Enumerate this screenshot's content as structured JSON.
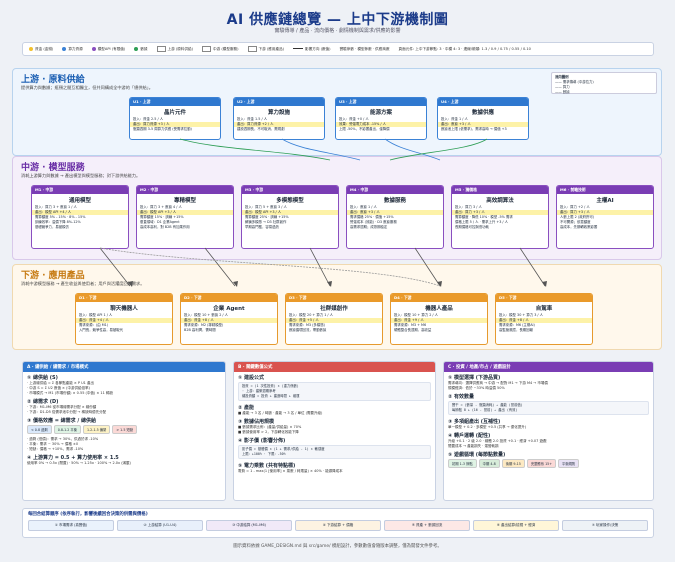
{
  "header": {
    "title": "AI 供應鏈總覽 — 上中下游機制圖",
    "subtitle": "實驗傳導 / 產品 · 流向價格 · 劇情機制與需求/供應的影響"
  },
  "legend": {
    "items": [
      {
        "label": "資金 (金錢)",
        "color": "#f2c12e",
        "kind": "dot"
      },
      {
        "label": "算力資源",
        "color": "#3b82d6",
        "kind": "dot"
      },
      {
        "label": "模型API (有限值)",
        "color": "#8a4fc0",
        "kind": "dot"
      },
      {
        "label": "數據",
        "color": "#2e9e55",
        "kind": "dot"
      },
      {
        "label": "上游 (原料供給)",
        "color": "#ffffff",
        "kind": "box"
      },
      {
        "label": "中游 (模型服務)",
        "color": "#ffffff",
        "kind": "box"
      },
      {
        "label": "下游 (應用產品)",
        "color": "#ffffff",
        "kind": "box"
      },
      {
        "label": "影響方向 (數值)",
        "color": "#333333",
        "kind": "line"
      },
      {
        "label": "實驗參數 · 模型參數 · 供應商數",
        "color": "#333333",
        "kind": "text"
      },
      {
        "label": "頁面元件: 上中下游節點: 3 · 中模 4: 3 · 連線/箭頭: 1.3 / 0.9 / 0.75 / 0.55 / 0.10",
        "color": "#333333",
        "kind": "text"
      }
    ]
  },
  "upstream": {
    "title": "上游 · 原料供給",
    "subtitle": "提供算力與數據；瓶頸之間互相獨立，但共同構成全中游的「總供給」。",
    "key_title": "流向圖例",
    "key_lines": [
      "—— 需求傳導 (中游拉力)",
      "—— 算力",
      "—— 數據"
    ],
    "cards": [
      {
        "code": "U1 · 上游",
        "name": "晶片元件",
        "lines": [
          "投入：資金 2.5 / 人",
          "產出：算力資源 +3 / 人",
          "瓶頸週期 3-5 周算力供應 (受需求拉動)"
        ]
      },
      {
        "code": "U2 · 上游",
        "name": "算力設施",
        "lines": [
          "投入：資金 1.5 / 人",
          "產出：算力資源 +2 / 人",
          "建設週期長，不可取消，需規劃"
        ]
      },
      {
        "code": "U3 · 上游",
        "name": "能源方案",
        "lines": [
          "投入：資金 +0 / 人",
          "效果：營運電力成本 -15% / 人",
          "上限 -50%，不影響產出，僅降價"
        ]
      },
      {
        "code": "U4 · 上游",
        "name": "數據供應",
        "lines": [
          "投入：資金 1 / 人",
          "產出：數據 +3 / 人",
          "數據池上限 (依需求)，需求高時 → 價值 +3"
        ]
      }
    ]
  },
  "midstream": {
    "title": "中游 · 模型服務",
    "subtitle": "消耗上游算力與數據 → 產出模型與模型服務；對下游供給能力。",
    "cards": [
      {
        "code": "M1 · 中游",
        "name": "通用模型",
        "lines": [
          "投入：算力 3 + 數據 1 / 人",
          "產出：模型 API +4 / 人",
          "需算額度 5% - 15% · 8% - 15%",
          "訓練效率：溢價下降 8%-12%",
          "基礎競爭力，易被模仿"
        ]
      },
      {
        "code": "M2 · 中游",
        "name": "專精模型",
        "lines": [
          "投入：算力 3 + 數據 4 / 人",
          "產出：模型 API +3 / 人",
          "需算額度 15% · 訓練 +15%",
          "垂直領域：D1 企業Agent",
          "高成本高利，對 B2B 有加乘作用"
        ]
      },
      {
        "code": "M3 · 中游",
        "name": "多模態模型",
        "lines": [
          "投入：算力 5 + 數據 3 / 人",
          "產出：模型 API +3 / 人",
          "需算額度 25% · 訓練 +15%",
          "解鎖多模態 → D3 社群創作",
          "早期高門檻，容易過熱"
        ]
      },
      {
        "code": "M4 · 中游",
        "name": "數據服務",
        "lines": [
          "投入：數據 1 / 人",
          "產出：數據 +3 / 人",
          "需求價格 25% · 價值 +15%",
          "營運成本 (效能) · D3 數據服務",
          "高需求週期；成熟期穩定"
        ]
      },
      {
        "code": "M5 · 獨價格",
        "name": "高效調算法",
        "lines": [
          "投入：算力 3 / 人",
          "產出：算力 +3 / 人",
          "需算額度 · 降低 10% · 模型 -5% 需求",
          "價格上限 5 / 人 · 需求上升 +3 / 人",
          "長期價格可控與低功耗"
        ]
      },
      {
        "code": "M6 · 前瞻技術",
        "name": "主權AI",
        "lines": [
          "投入：算力 +2 / 人",
          "產出：算力 +3 / 人",
          "人數上限 2 (政府許可)",
          "不可開源；依靠額度",
          "高成本，先期轉政策影響"
        ]
      }
    ]
  },
  "downstream": {
    "title": "下游 · 應用產品",
    "subtitle": "消耗中游模型服務 → 產生收益與使用者；用戶與活躍度回饋需求。",
    "cards": [
      {
        "code": "D1 · 下游",
        "name": "聊天機器人",
        "lines": [
          "投入：模型 API 1 / 人",
          "產出：資金 +4 / 人",
          "需求來源：(由 M1)",
          "入門長，競爭性高，易被取代"
        ]
      },
      {
        "code": "D2 · 下游",
        "name": "企業 Agent",
        "lines": [
          "投入：模型 10 + 數據 2 / 人",
          "產出：資金 +8 / 人",
          "需求來源：M2 (專精模型)",
          "B2B 高利潤，需時間"
        ]
      },
      {
        "code": "D3 · 下游",
        "name": "社群媒創作",
        "lines": [
          "投入：模型 20 + 算力 1 / 人",
          "產出：資金 +5 / 人",
          "需求來源：M3 (多模態)",
          "數據循環回流，帶動數據"
        ]
      },
      {
        "code": "D4 · 下游",
        "name": "機器人產品",
        "lines": [
          "投入：模型 10 + 算力 2 / 人",
          "產出：資金 +9 / 人",
          "需求來源：M3 + M6",
          "硬體整合長週期，高收益"
        ]
      },
      {
        "code": "D5 · 下游",
        "name": "自駕車",
        "lines": [
          "投入：模型 30 + 算力 3 / 人",
          "產出：資金 +8 / 人",
          "需求來源：M6 (主權AI)",
          "高監管風險，長期回報"
        ]
      }
    ]
  },
  "panel_a": {
    "header": "A · 總供給 / 總需求 / 市場模式",
    "sections": [
      {
        "title": "① 總供給 (S)",
        "lines": [
          "· 上游總供給 = Σ 各節點產能 × P U1 產出",
          "· 中游 S = Σ U2 數值 × (中游供給倍率)",
          "· 市場模式 → M1 (市場份額) × 0.55 (中值) × 11 稀缺"
        ]
      },
      {
        "title": "② 總需求 (D)",
        "lines": [
          "· 下游：M1-M6 從市場總需求分配 × 總份額",
          "· 下游：D1-D5 從需求池中分配 → 稀缺時優先分配"
        ]
      },
      {
        "title": "③ 價格效應 = 總需求 / 總供給",
        "lines": []
      },
      {
        "title": "",
        "lines": [
          "· 過剩 (低價)：需求 → 30%，供過於求 -10%",
          "· 平衡：需求 ~ 30% → 價格 ±0",
          "· 短缺：價格 → +10%，需求 -10%"
        ]
      },
      {
        "title": "④ 上游算力 = 0.5 + 算力使用率 × 1.5",
        "lines": [
          "使用率 0% → 0.5x (閒置) · 50% → 1.25x · 100% → 2.0x (滿載)"
        ]
      }
    ],
    "chips": [
      "< 0.8 過剩",
      "0.8-1.2 平衡",
      "1.2-1.5 偏緊",
      "> 1.5 短缺"
    ]
  },
  "panel_b": {
    "header": "B · 關鍵數值公式",
    "sections": [
      {
        "title": "① 建設公式",
        "code": [
          "投資 = (1 次性投資) × (重力係數)",
          "· 上游：建築週期參考",
          "總投資額 = 投資 + 建造時間 + 維運"
        ]
      },
      {
        "title": "② 產能",
        "lines": [
          "■ 產能 → 3 名 / 時脈 · 產能 → 3 名 / 單位 (需要升級)"
        ]
      },
      {
        "title": "③ 數據佔用規模",
        "lines": [
          "■ 數據需求比例：(產量/供給量) × 70%",
          "■ 數據使用率 > 2，下游轉化效能下降"
        ]
      },
      {
        "title": "④ 影子價 (影響分佈)",
        "code": [
          "影子價 = 基礎價 × (1 + 需求/供給 - 1) × 敏感度",
          "上限：+100% · 下限：-50%"
        ]
      },
      {
        "title": "⑤ 電力乘數 (共有特點標)",
        "lines": [
          "電費 = 1 - max(1 [使用率] × 乘數 / 耗電量) × 40% · 能源降成本"
        ]
      }
    ]
  },
  "panel_c": {
    "header": "C · 投資 / 地產/市占 / 遊戲設計",
    "sections": [
      {
        "title": "① 模型選擇 (下游品質)",
        "lines": [
          "需求導向：選擇供應商 → 中游 → 配對 M1 → 下游 M4 → 市場價",
          "規模經濟：低於 ~33% 時溢價 50%"
        ]
      },
      {
        "title": "② 有效數量",
        "code": [
          "實干 = (數量 - 瓶頸消耗) → 產能 (當前值)",
          "每節點 8 + (16 - 當前) → 產出 (有效)"
        ]
      },
      {
        "title": "③ 多項組產出 (互補性)",
        "lines": [
          "單一模型 + 0.2 · 多模型 +0.5 (共享 → 優化提升)"
        ]
      },
      {
        "title": "④ 轉戶運轉 (配性)",
        "lines": [
          "升級 +0.1 · 2 級 2.0 · 總體 2.0 投資 +0.1 · 經濟 +0.07 遊戲",
          "閒置成本 → 產能損失 · 運營耗損"
        ]
      },
      {
        "title": "⑤ 遊戲循環 (每節點數量)",
        "lines": []
      }
    ],
    "chips": [
      "初期 1-3 節點",
      "中期 4-8",
      "後期 9-15",
      "完整體系 15+",
      "平衡規則"
    ]
  },
  "bottom": {
    "title": "每回合結算順序 (依序執行，影響後續回合決策的供需與價格)",
    "steps": [
      "① 市場需求 (真實值)",
      "② 上游結算 (U1-U4)",
      "③ 中游結算 (M1-M6)",
      "④ 下游結算 + 價格",
      "⑤ 資產 + 數據回流",
      "⑥ 產出結算/檢視 + 經濟",
      "⑦ 玩家操作/決策"
    ]
  },
  "footer": "圖示資料依據 GAME_DESIGN.md 與 src/game/ 模組設計，參數數值會隨版本調整，僅為開發文件參考。",
  "colors": {
    "up": "#2f78cf",
    "mid": "#7a3db4",
    "down": "#ea9a2a",
    "panel_a": "#2f78cf",
    "panel_b": "#d9534f",
    "panel_c": "#7a3db4"
  }
}
